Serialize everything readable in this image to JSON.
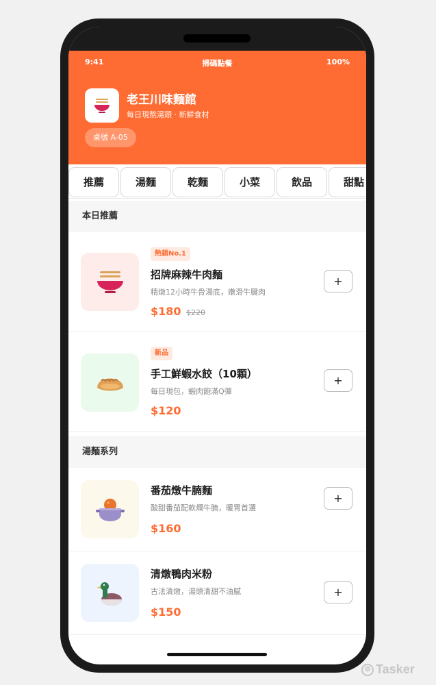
{
  "status": {
    "time": "9:41",
    "title": "掃碼點餐",
    "battery": "100%"
  },
  "shop": {
    "name": "老王川味麵館",
    "tagline": "每日現熬湯頭 · 新鮮食材",
    "table": "桌號 A-05",
    "logo_icon": "noodle-bowl-icon"
  },
  "tabs": [
    {
      "label": "推薦"
    },
    {
      "label": "湯麵"
    },
    {
      "label": "乾麵"
    },
    {
      "label": "小菜"
    },
    {
      "label": "飲品"
    },
    {
      "label": "甜點"
    }
  ],
  "sections": [
    {
      "title": "本日推薦",
      "items": [
        {
          "badge": "熱銷No.1",
          "name": "招牌麻辣牛肉麵",
          "desc": "精燉12小時牛骨湯底，嫩滑牛腱肉",
          "price": "$180",
          "old_price": "$220",
          "icon": "noodle-bowl-icon",
          "thumb_color": "#fdecea"
        },
        {
          "badge": "新品",
          "name": "手工鮮蝦水餃（10顆）",
          "desc": "每日現包，蝦肉飽滿Q彈",
          "price": "$120",
          "icon": "dumpling-icon",
          "thumb_color": "#eafbee"
        }
      ]
    },
    {
      "title": "湯麵系列",
      "items": [
        {
          "name": "番茄燉牛腩麵",
          "desc": "酸甜番茄配軟爛牛腩，暖胃首選",
          "price": "$160",
          "icon": "stew-pot-icon",
          "thumb_color": "#fdf8ec"
        },
        {
          "name": "清燉鴨肉米粉",
          "desc": "古法清燉，湯頭清甜不油膩",
          "price": "$150",
          "icon": "duck-icon",
          "thumb_color": "#edf4fd"
        }
      ]
    }
  ],
  "add_label": "+",
  "watermark": "Tasker",
  "colors": {
    "accent": "#fe6c33",
    "badge_bg": "#ffeae1"
  }
}
